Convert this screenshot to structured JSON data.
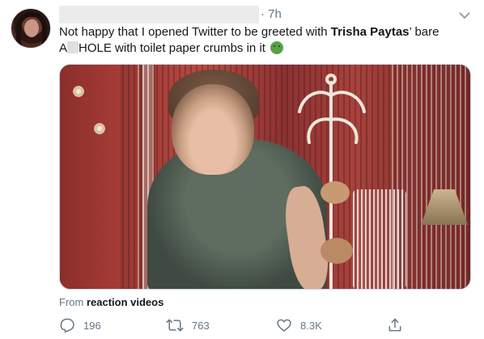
{
  "tweet": {
    "time": "7h",
    "text_part1": "Not happy that I opened Twitter to be greeted with ",
    "text_bold": "Trisha Paytas",
    "text_part2": "’ bare",
    "text_line2_a": "A",
    "text_line2_b": "HOLE with toilet paper crumbs in it",
    "emoji": "sick-face-emoji",
    "source_prefix": "From",
    "source_name": "reaction videos"
  },
  "actions": {
    "reply_count": "196",
    "retweet_count": "763",
    "like_count": "8.3K"
  },
  "icons": {
    "caret": "chevron-down-icon",
    "reply": "reply-icon",
    "retweet": "retweet-icon",
    "like": "heart-icon",
    "share": "share-icon"
  },
  "colors": {
    "muted": "#657786",
    "text": "#14171a",
    "emoji_green": "#59a04a"
  }
}
